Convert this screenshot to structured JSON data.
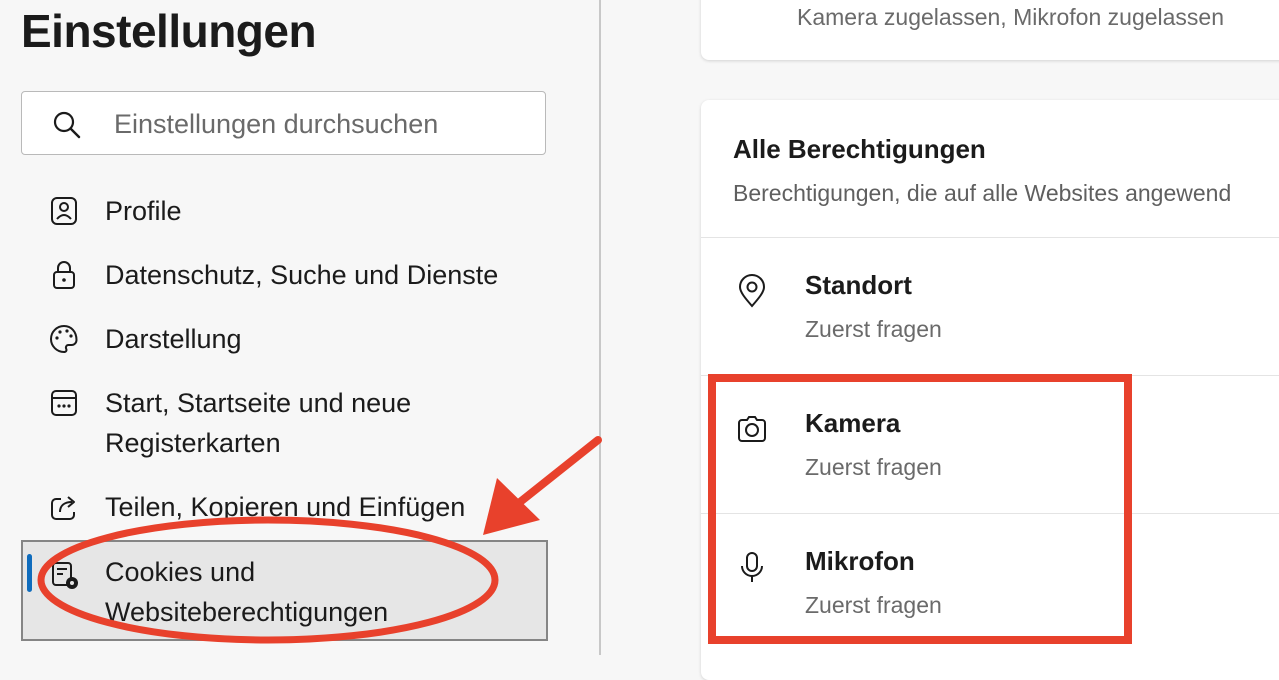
{
  "sidebar": {
    "title": "Einstellungen",
    "search_placeholder": "Einstellungen durchsuchen",
    "items": [
      {
        "label": "Profile",
        "icon": "profile-icon"
      },
      {
        "label": "Datenschutz, Suche und Dienste",
        "icon": "lock-icon"
      },
      {
        "label": "Darstellung",
        "icon": "palette-icon"
      },
      {
        "label_line1": "Start, Startseite und neue",
        "label_line2": "Registerkarten",
        "icon": "home-icon"
      },
      {
        "label": "Teilen, Kopieren und Einfügen",
        "icon": "share-icon"
      },
      {
        "label_line1": "Cookies und",
        "label_line2": "Websiteberechtigungen",
        "icon": "cookie-settings-icon",
        "active": true
      }
    ]
  },
  "main": {
    "top_card_text": "Kamera zugelassen, Mikrofon zugelassen",
    "permissions": {
      "heading": "Alle Berechtigungen",
      "description": "Berechtigungen, die auf alle Websites angewend",
      "rows": [
        {
          "title": "Standort",
          "status": "Zuerst fragen",
          "icon": "location-icon"
        },
        {
          "title": "Kamera",
          "status": "Zuerst fragen",
          "icon": "camera-icon"
        },
        {
          "title": "Mikrofon",
          "status": "Zuerst fragen",
          "icon": "microphone-icon"
        }
      ]
    }
  },
  "colors": {
    "annotation_red": "#e8412c",
    "accent_blue": "#0f6cbd"
  }
}
